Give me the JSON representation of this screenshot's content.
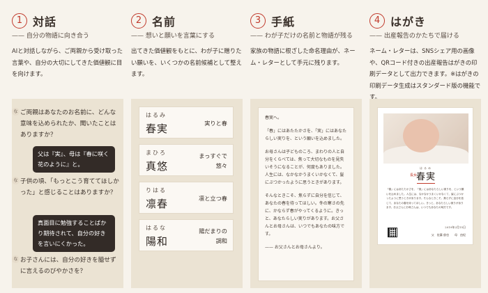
{
  "columns": [
    {
      "num": "1",
      "title": "対話",
      "subtitle": "—— 自分の物語に向き合う",
      "desc": "AIと対話しながら、ご両親から受け取った言葉や、自分の大切にしてきた価値観に目を向けます。",
      "chat": {
        "q1": "ご両親はあなたのお名前に、どんな意味を込められたか、聞いたことはありますか？",
        "a1": "父は『実』、母は『春に咲く花のように』と。",
        "q2": "子供の頃、「もっとこう育ててほしかった」と感じることはありますか？",
        "a2": "真面目に勉強することばかり期待されて、自分の好きを言いにくかった。",
        "q3": "お子さんには、自分の好きを臆せずに言えるのびやかさを？",
        "marker": "な"
      }
    },
    {
      "num": "2",
      "title": "名前",
      "subtitle": "—— 想いと願いを言葉にする",
      "desc": "出てきた価値観をもとに、わが子に贈りたい願いを、いくつかの名前候補として整えます。",
      "cards": [
        {
          "kana": "はるみ",
          "kanji": "春実",
          "meaning": "実りと春"
        },
        {
          "kana": "まひろ",
          "kanji": "真悠",
          "meaning": "まっすぐで\n悠々"
        },
        {
          "kana": "りはる",
          "kanji": "凛春",
          "meaning": "凛と立つ春"
        },
        {
          "kana": "はるな",
          "kanji": "陽和",
          "meaning": "陽だまりの\n調和"
        }
      ]
    },
    {
      "num": "3",
      "title": "手紙",
      "subtitle": "—— わが子だけの名前と物語が残る",
      "desc": "家族の物語に根ざした命名理由が、ネーム・レターとして手元に残ります。",
      "letter": [
        "春実へ。",
        "「春」にはあたたかさを、「実」にはあなたらしい実りを、という願いを込めました。",
        "お母さんは子どものころ、まわりの人と自分をくらべては、焦って大切なものを見失いそうになることが、何度もありました。人生には、なかなかうまくいかなくて、髪にぶつかったように思うときがあります。",
        "そんなときこそ、焦らずに自分を信じて、あなたの春を待ってほしい。冬の寒さの先に、かならず春がやってくるように。きっと、あなたらしい実りがあります。お父さんとお母さんは、いつでもあなたの味方です。",
        "—— お父さんとお母さんより。"
      ]
    },
    {
      "num": "4",
      "title": "はがき",
      "subtitle": "—— 出産報告のかたちで届ける",
      "desc": "ネーム・レターは、SNSシェア用の画像や、QRコード付きの出産報告はがきの印刷データとして出力できます。※はがきの印刷データ生成はスタンダード版の機能です。",
      "postcard": {
        "kana": "はるみ",
        "label": "長女",
        "name": "春実",
        "body": "「春」にはあたたかさを、「実」にはあなたらしい実りを、という願いを込めました。人生には、なかなかうまくいかなくて、髪にぶつかったように思うときがあります。そんなときこそ、焦らずに自分を信じて、あなたの春を待ってほしい。きっと、あなたらしい実りがあります。お父さんとお母さんは、いつでもあなたの味方です。",
        "date": "2019年2月15日",
        "sign": "父　佐藤 俊也　　母　由紀"
      }
    }
  ]
}
